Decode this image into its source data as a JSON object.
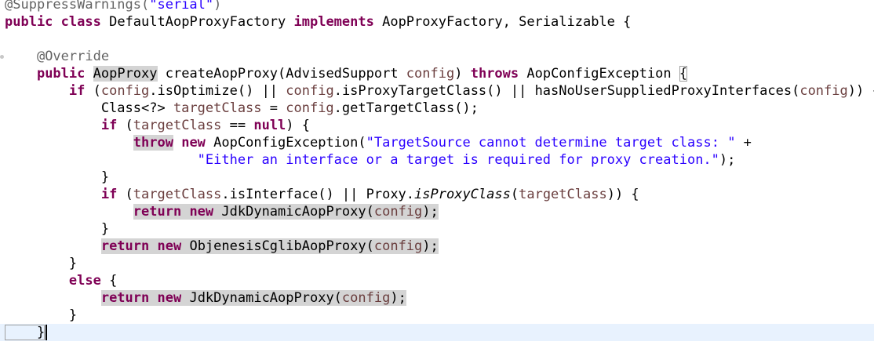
{
  "editor": {
    "lines": [
      {
        "tokens": [
          {
            "t": "@SuppressWarnings(",
            "c": "ann"
          },
          {
            "t": "\"serial\"",
            "c": "str"
          },
          {
            "t": ")",
            "c": "ann"
          }
        ]
      },
      {
        "tokens": [
          {
            "t": "public",
            "c": "kw"
          },
          {
            "t": " ",
            "c": "pl"
          },
          {
            "t": "class",
            "c": "kw"
          },
          {
            "t": " DefaultAopProxyFactory ",
            "c": "pl"
          },
          {
            "t": "implements",
            "c": "kw"
          },
          {
            "t": " AopProxyFactory, Serializable {",
            "c": "pl"
          }
        ]
      },
      {
        "tokens": []
      },
      {
        "tokens": [
          {
            "t": "    ",
            "c": "pl"
          },
          {
            "t": "@Override",
            "c": "ann"
          }
        ]
      },
      {
        "tokens": [
          {
            "t": "    ",
            "c": "pl"
          },
          {
            "t": "public",
            "c": "kw"
          },
          {
            "t": " ",
            "c": "pl"
          },
          {
            "t": "AopProxy",
            "c": "pl",
            "hl": true
          },
          {
            "t": " createAopProxy(AdvisedSupport ",
            "c": "pl"
          },
          {
            "t": "config",
            "c": "field"
          },
          {
            "t": ") ",
            "c": "pl"
          },
          {
            "t": "throws",
            "c": "kw"
          },
          {
            "t": " AopConfigException ",
            "c": "pl"
          },
          {
            "t": "{",
            "c": "pl",
            "box": true
          }
        ]
      },
      {
        "tokens": [
          {
            "t": "        ",
            "c": "pl"
          },
          {
            "t": "if",
            "c": "kw"
          },
          {
            "t": " (",
            "c": "pl"
          },
          {
            "t": "config",
            "c": "field"
          },
          {
            "t": ".isOptimize() || ",
            "c": "pl"
          },
          {
            "t": "config",
            "c": "field"
          },
          {
            "t": ".isProxyTargetClass() || hasNoUserSuppliedProxyInterfaces(",
            "c": "pl"
          },
          {
            "t": "config",
            "c": "field"
          },
          {
            "t": ")) {",
            "c": "pl"
          }
        ]
      },
      {
        "tokens": [
          {
            "t": "            Class<?> ",
            "c": "pl"
          },
          {
            "t": "targetClass",
            "c": "field"
          },
          {
            "t": " = ",
            "c": "pl"
          },
          {
            "t": "config",
            "c": "field"
          },
          {
            "t": ".getTargetClass();",
            "c": "pl"
          }
        ]
      },
      {
        "tokens": [
          {
            "t": "            ",
            "c": "pl"
          },
          {
            "t": "if",
            "c": "kw"
          },
          {
            "t": " (",
            "c": "pl"
          },
          {
            "t": "targetClass",
            "c": "field"
          },
          {
            "t": " == ",
            "c": "pl"
          },
          {
            "t": "null",
            "c": "kw"
          },
          {
            "t": ") {",
            "c": "pl"
          }
        ]
      },
      {
        "tokens": [
          {
            "t": "                ",
            "c": "pl"
          },
          {
            "t": "throw",
            "c": "kw",
            "hl": true
          },
          {
            "t": " ",
            "c": "pl"
          },
          {
            "t": "new",
            "c": "kw"
          },
          {
            "t": " AopConfigException(",
            "c": "pl"
          },
          {
            "t": "\"TargetSource cannot determine target class: \"",
            "c": "str"
          },
          {
            "t": " +",
            "c": "pl"
          }
        ]
      },
      {
        "tokens": [
          {
            "t": "                        ",
            "c": "pl"
          },
          {
            "t": "\"Either an interface or a target is required for proxy creation.\"",
            "c": "str"
          },
          {
            "t": ");",
            "c": "pl"
          }
        ]
      },
      {
        "tokens": [
          {
            "t": "            }",
            "c": "pl"
          }
        ]
      },
      {
        "tokens": [
          {
            "t": "            ",
            "c": "pl"
          },
          {
            "t": "if",
            "c": "kw"
          },
          {
            "t": " (",
            "c": "pl"
          },
          {
            "t": "targetClass",
            "c": "field"
          },
          {
            "t": ".isInterface() || Proxy.",
            "c": "pl"
          },
          {
            "t": "isProxyClass",
            "c": "static"
          },
          {
            "t": "(",
            "c": "pl"
          },
          {
            "t": "targetClass",
            "c": "field"
          },
          {
            "t": ")) {",
            "c": "pl"
          }
        ]
      },
      {
        "tokens": [
          {
            "t": "                ",
            "c": "pl"
          },
          {
            "t": "return",
            "c": "kw",
            "hl": true
          },
          {
            "t": " ",
            "c": "pl",
            "hl": true
          },
          {
            "t": "new",
            "c": "kw",
            "hl": true
          },
          {
            "t": " JdkDynamicAopProxy(",
            "c": "pl",
            "hl": true
          },
          {
            "t": "config",
            "c": "field",
            "hl": true
          },
          {
            "t": ");",
            "c": "pl",
            "hl": true
          }
        ]
      },
      {
        "tokens": [
          {
            "t": "            }",
            "c": "pl"
          }
        ]
      },
      {
        "tokens": [
          {
            "t": "            ",
            "c": "pl"
          },
          {
            "t": "return",
            "c": "kw",
            "hl": true
          },
          {
            "t": " ",
            "c": "pl",
            "hl": true
          },
          {
            "t": "new",
            "c": "kw",
            "hl": true
          },
          {
            "t": " ObjenesisCglibAopProxy(",
            "c": "pl",
            "hl": true
          },
          {
            "t": "config",
            "c": "field",
            "hl": true
          },
          {
            "t": ");",
            "c": "pl",
            "hl": true
          }
        ]
      },
      {
        "tokens": [
          {
            "t": "        }",
            "c": "pl"
          }
        ]
      },
      {
        "tokens": [
          {
            "t": "        ",
            "c": "pl"
          },
          {
            "t": "else",
            "c": "kw"
          },
          {
            "t": " {",
            "c": "pl"
          }
        ]
      },
      {
        "tokens": [
          {
            "t": "            ",
            "c": "pl"
          },
          {
            "t": "return",
            "c": "kw",
            "hl": true
          },
          {
            "t": " ",
            "c": "pl",
            "hl": true
          },
          {
            "t": "new",
            "c": "kw",
            "hl": true
          },
          {
            "t": " JdkDynamicAopProxy(",
            "c": "pl",
            "hl": true
          },
          {
            "t": "config",
            "c": "field",
            "hl": true
          },
          {
            "t": ");",
            "c": "pl",
            "hl": true
          }
        ]
      },
      {
        "tokens": [
          {
            "t": "        }",
            "c": "pl"
          }
        ]
      },
      {
        "tokens": [
          {
            "t": "    }",
            "c": "pl",
            "box": true
          }
        ],
        "current": true,
        "caret": true
      }
    ]
  },
  "colors": {
    "keyword": "#7f0055",
    "string": "#2a00ff",
    "annotation": "#646464",
    "field": "#6a3e3e",
    "highlight": "#d4d4d4",
    "current_line": "#e8f2fe"
  }
}
